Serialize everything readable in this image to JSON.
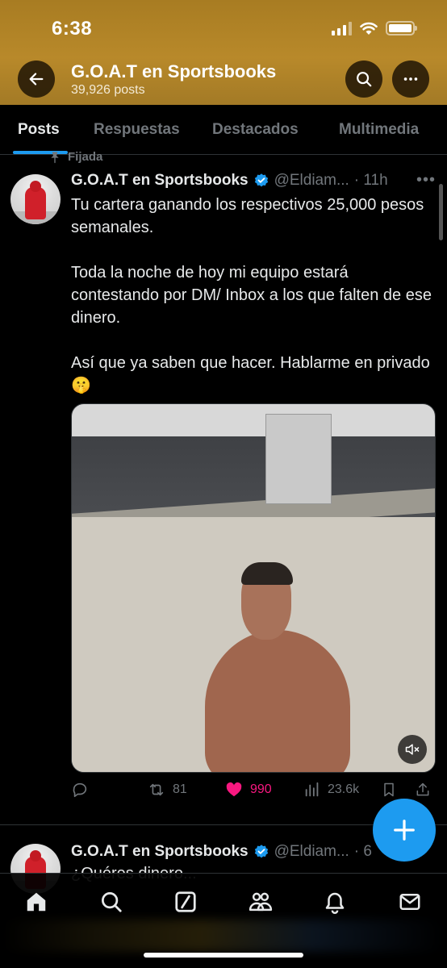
{
  "status_bar": {
    "time": "6:38"
  },
  "header": {
    "title": "G.O.A.T en Sportsbooks",
    "post_count": "39,926 posts"
  },
  "tabs": [
    "Posts",
    "Respuestas",
    "Destacados",
    "Multimedia"
  ],
  "pinned_post": {
    "pinned_label": "Fijada",
    "author_name": "G.O.A.T en Sportsbooks",
    "handle": "@Eldiam...",
    "time": "· 11h",
    "paragraphs": [
      "Tu cartera ganando los respectivos 25,000 pesos semanales.",
      "Toda la noche de hoy mi equipo estará contestando por DM/ Inbox a los que falten de ese dinero.",
      "Así que ya saben que hacer. Hablarme en privado 🤫"
    ],
    "actions": {
      "reposts": "81",
      "likes": "990",
      "views": "23.6k"
    }
  },
  "second_post": {
    "author_name": "G.O.A.T en Sportsbooks",
    "handle": "@Eldiam...",
    "time": "· 6",
    "text_preview": "¿Quéres dinero..."
  },
  "colors": {
    "header_bg": "#b8892a",
    "accent": "#1d9bf0",
    "like": "#f91880",
    "muted": "#71767b"
  },
  "icons": [
    "back-arrow-icon",
    "search-icon",
    "more-icon",
    "pin-icon",
    "verified-icon",
    "reply-icon",
    "repost-icon",
    "heart-icon",
    "views-icon",
    "bookmark-icon",
    "share-icon",
    "mute-icon",
    "plus-icon",
    "home-icon",
    "explore-icon",
    "grok-icon",
    "communities-icon",
    "notifications-icon",
    "messages-icon"
  ]
}
